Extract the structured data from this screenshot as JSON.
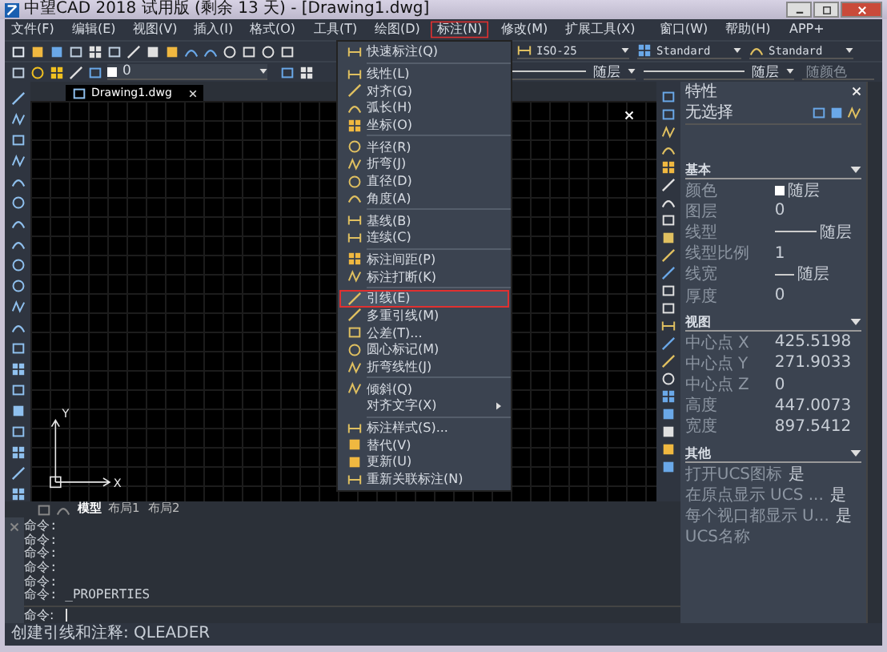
{
  "window": {
    "title": "中望CAD 2018 试用版 (剩余 13 天) - [Drawing1.dwg]"
  },
  "menu_bar": [
    {
      "label": "文件(F)",
      "selected": false
    },
    {
      "label": "编辑(E)",
      "selected": false
    },
    {
      "label": "视图(V)",
      "selected": false
    },
    {
      "label": "插入(I)",
      "selected": false
    },
    {
      "label": "格式(O)",
      "selected": false
    },
    {
      "label": "工具(T)",
      "selected": false
    },
    {
      "label": "绘图(D)",
      "selected": false
    },
    {
      "label": "标注(N)",
      "selected": true
    },
    {
      "label": "修改(M)",
      "selected": false
    },
    {
      "label": "扩展工具(X)",
      "selected": false
    },
    {
      "label": "窗口(W)",
      "selected": false
    },
    {
      "label": "帮助(H)",
      "selected": false
    },
    {
      "label": "APP+",
      "selected": false
    }
  ],
  "toolbar": {
    "layer": "0",
    "dim_style": "ISO-25",
    "text_style": "Standard",
    "table_style": "Standard",
    "linetype": "随层",
    "lineweight": "随层",
    "plot_style": "随颜色"
  },
  "document_tabs": [
    {
      "label": "Drawing1.dwg",
      "selected": true
    }
  ],
  "ucs": {
    "x_label": "X",
    "y_label": "Y"
  },
  "layout_tabs": [
    {
      "label": "模型",
      "selected": true
    },
    {
      "label": "布局1",
      "selected": false
    },
    {
      "label": "布局2",
      "selected": false
    }
  ],
  "command_history": [
    "命令:",
    "命令:",
    "命令:",
    "命令:",
    "命令:",
    "命令: _PROPERTIES"
  ],
  "command_prompt": "命令:",
  "status_bar": "创建引线和注释: QLEADER",
  "dimension_menu": [
    [
      {
        "label": "快速标注(Q)",
        "icon": true,
        "submenu": false,
        "selected": false
      }
    ],
    [
      {
        "label": "线性(L)",
        "icon": true,
        "submenu": false,
        "selected": false
      },
      {
        "label": "对齐(G)",
        "icon": true,
        "submenu": false,
        "selected": false
      },
      {
        "label": "弧长(H)",
        "icon": true,
        "submenu": false,
        "selected": false
      },
      {
        "label": "坐标(O)",
        "icon": true,
        "submenu": false,
        "selected": false
      }
    ],
    [
      {
        "label": "半径(R)",
        "icon": true,
        "submenu": false,
        "selected": false
      },
      {
        "label": "折弯(J)",
        "icon": true,
        "submenu": false,
        "selected": false
      },
      {
        "label": "直径(D)",
        "icon": true,
        "submenu": false,
        "selected": false
      },
      {
        "label": "角度(A)",
        "icon": true,
        "submenu": false,
        "selected": false
      }
    ],
    [
      {
        "label": "基线(B)",
        "icon": true,
        "submenu": false,
        "selected": false
      },
      {
        "label": "连续(C)",
        "icon": true,
        "submenu": false,
        "selected": false
      }
    ],
    [
      {
        "label": "标注间距(P)",
        "icon": true,
        "submenu": false,
        "selected": false
      },
      {
        "label": "标注打断(K)",
        "icon": true,
        "submenu": false,
        "selected": false
      }
    ],
    [
      {
        "label": "引线(E)",
        "icon": true,
        "submenu": false,
        "selected": true
      },
      {
        "label": "多重引线(M)",
        "icon": true,
        "submenu": false,
        "selected": false
      },
      {
        "label": "公差(T)...",
        "icon": true,
        "submenu": false,
        "selected": false
      },
      {
        "label": "圆心标记(M)",
        "icon": true,
        "submenu": false,
        "selected": false
      },
      {
        "label": "折弯线性(J)",
        "icon": true,
        "submenu": false,
        "selected": false
      }
    ],
    [
      {
        "label": "倾斜(Q)",
        "icon": true,
        "submenu": false,
        "selected": false
      },
      {
        "label": "对齐文字(X)",
        "icon": false,
        "submenu": true,
        "selected": false
      }
    ],
    [
      {
        "label": "标注样式(S)...",
        "icon": true,
        "submenu": false,
        "selected": false
      },
      {
        "label": "替代(V)",
        "icon": true,
        "submenu": false,
        "selected": false
      },
      {
        "label": "更新(U)",
        "icon": true,
        "submenu": false,
        "selected": false
      },
      {
        "label": "重新关联标注(N)",
        "icon": true,
        "submenu": false,
        "selected": false
      }
    ]
  ],
  "properties": {
    "title": "特性",
    "selection": "无选择",
    "sections": [
      {
        "title": "基本",
        "rows": [
          {
            "label": "颜色",
            "value": "随层",
            "kind": "swatch"
          },
          {
            "label": "图层",
            "value": "0",
            "kind": "text"
          },
          {
            "label": "线型",
            "value": "随层",
            "kind": "line"
          },
          {
            "label": "线型比例",
            "value": "1",
            "kind": "text"
          },
          {
            "label": "线宽",
            "value": "随层",
            "kind": "weight"
          },
          {
            "label": "厚度",
            "value": "0",
            "kind": "text"
          }
        ]
      },
      {
        "title": "视图",
        "rows": [
          {
            "label": "中心点 X",
            "value": "425.5198",
            "kind": "text"
          },
          {
            "label": "中心点 Y",
            "value": "271.9033",
            "kind": "text"
          },
          {
            "label": "中心点 Z",
            "value": "0",
            "kind": "text"
          },
          {
            "label": "高度",
            "value": "447.0073",
            "kind": "text"
          },
          {
            "label": "宽度",
            "value": "897.5412",
            "kind": "text"
          }
        ]
      },
      {
        "title": "其他",
        "rows": [
          {
            "label": "打开UCS图标",
            "value": "是",
            "kind": "text"
          },
          {
            "label": "在原点显示 UCS ...",
            "value": "是",
            "kind": "text"
          },
          {
            "label": "每个视口都显示 U...",
            "value": "是",
            "kind": "text"
          },
          {
            "label": "UCS名称"
          }
        ]
      }
    ]
  }
}
